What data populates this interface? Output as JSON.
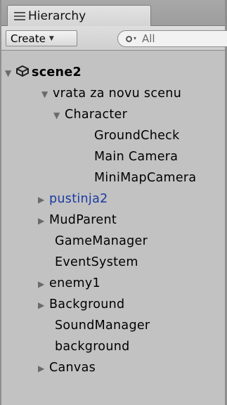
{
  "window": {
    "tab_label": "Hierarchy"
  },
  "toolbar": {
    "create_label": "Create",
    "search_placeholder": "All"
  },
  "scene": {
    "name": "scene2"
  },
  "items": [
    {
      "label": "vrata za novu scenu",
      "expanded": true
    },
    {
      "label": "Character",
      "expanded": true
    },
    {
      "label": "GroundCheck"
    },
    {
      "label": "Main Camera"
    },
    {
      "label": "MiniMapCamera"
    },
    {
      "label": "pustinja2",
      "collapsed": true,
      "prefab_color": "#1c3aa0"
    },
    {
      "label": "MudParent",
      "collapsed": true
    },
    {
      "label": "GameManager"
    },
    {
      "label": "EventSystem"
    },
    {
      "label": "enemy1",
      "collapsed": true
    },
    {
      "label": "Background",
      "collapsed": true
    },
    {
      "label": "SoundManager"
    },
    {
      "label": "background"
    },
    {
      "label": "Canvas",
      "collapsed": true
    }
  ]
}
